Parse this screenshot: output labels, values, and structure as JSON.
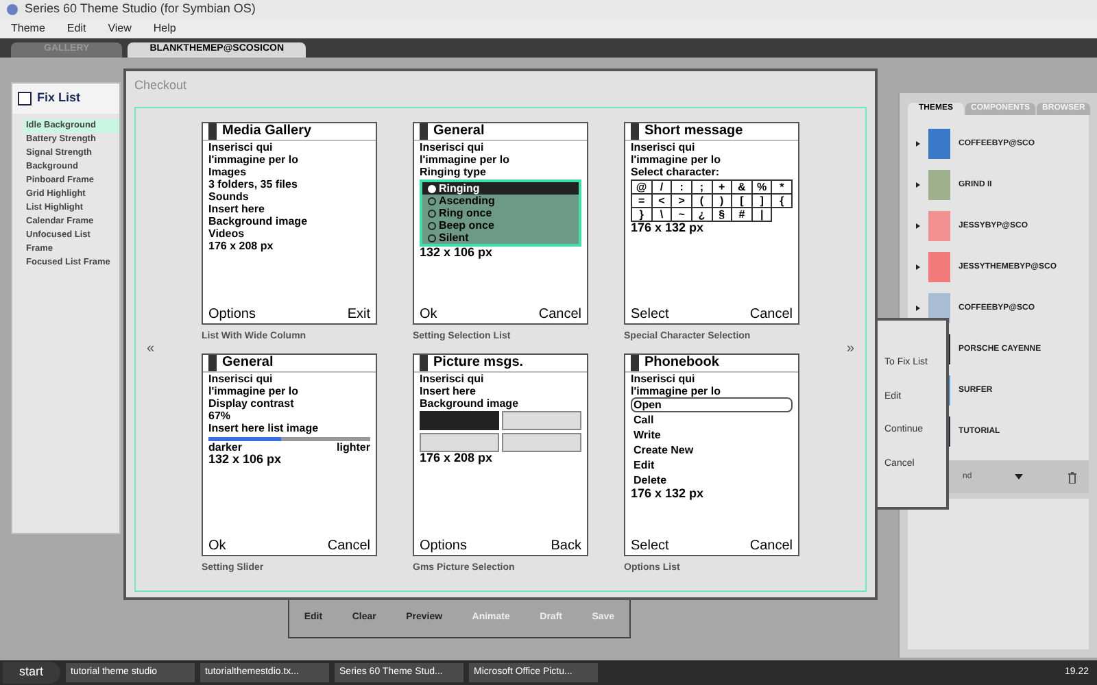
{
  "window": {
    "title": "Series 60 Theme Studio (for Symbian OS)"
  },
  "menu": [
    "Theme",
    "Edit",
    "View",
    "Help"
  ],
  "tabs": [
    {
      "label": "GALLERY",
      "selected": false
    },
    {
      "label": "BLANKTHEMEP@SCOSICON",
      "selected": true
    }
  ],
  "fix_list": {
    "title": "Fix List",
    "items": [
      {
        "label": "Idle Background",
        "selected": true
      },
      {
        "label": "Battery Strength",
        "selected": false
      },
      {
        "label": "Signal Strength",
        "selected": false
      },
      {
        "label": "Background",
        "selected": false
      },
      {
        "label": "Pinboard Frame",
        "selected": false
      },
      {
        "label": "Grid Highlight",
        "selected": false
      },
      {
        "label": "List Highlight",
        "selected": false
      },
      {
        "label": "Calendar Frame",
        "selected": false
      },
      {
        "label": "Unfocused List Frame",
        "selected": false
      },
      {
        "label": "Focused List Frame",
        "selected": false
      }
    ]
  },
  "checkout": {
    "title": "Checkout",
    "prev": "«",
    "next": "»",
    "screens": [
      {
        "kind": "list",
        "title": "Media Gallery",
        "lines": [
          "Inserisci qui",
          "l'immagine per lo",
          "Images",
          "3 folders, 35 files",
          "Sounds",
          "Insert here",
          "Background image",
          "Videos",
          "176 x 208 px"
        ],
        "softkeys": [
          "Options",
          "Exit"
        ],
        "caption": "List With Wide Column"
      },
      {
        "kind": "radio",
        "title": "General",
        "lines": [
          "Inserisci qui",
          "l'immagine per lo",
          "Ringing type"
        ],
        "options": [
          {
            "label": "Ringing",
            "selected": true
          },
          {
            "label": "Ascending",
            "selected": false
          },
          {
            "label": "Ring once",
            "selected": false
          },
          {
            "label": "Beep once",
            "selected": false
          },
          {
            "label": "Silent",
            "selected": false
          }
        ],
        "footer": "132 x 106 px",
        "softkeys": [
          "Ok",
          "Cancel"
        ],
        "caption": "Setting Selection List"
      },
      {
        "kind": "chars",
        "title": "Short message",
        "lines": [
          "Inserisci qui",
          "l'immagine per lo",
          "Select character:"
        ],
        "chars": [
          "@",
          "/",
          ":",
          ";",
          "+",
          "&",
          "%",
          "*",
          "=",
          "<",
          ">",
          "(",
          ")",
          "[",
          "]",
          "{",
          "}",
          "\\",
          "~",
          "¿",
          "§",
          "#",
          "|"
        ],
        "footer": "176 x 132 px",
        "softkeys": [
          "Select",
          "Cancel"
        ],
        "caption": "Special Character Selection"
      },
      {
        "kind": "slider",
        "title": "General",
        "lines": [
          "Inserisci qui",
          "l'immagine per lo",
          "Display contrast",
          "67%",
          "Insert here list image"
        ],
        "level": 0.45,
        "ends": [
          "darker",
          "lighter"
        ],
        "footer": "132 x 106 px",
        "softkeys": [
          "Ok",
          "Cancel"
        ],
        "caption": "Setting Slider"
      },
      {
        "kind": "pictures",
        "title": "Picture msgs.",
        "lines": [
          "Inserisci qui",
          "Insert here",
          "Background image"
        ],
        "footer": "176 x 208 px",
        "softkeys": [
          "Options",
          "Back"
        ],
        "caption": "Gms Picture Selection"
      },
      {
        "kind": "options",
        "title": "Phonebook",
        "lines": [
          "Inserisci qui",
          "l'immagine per lo"
        ],
        "options": [
          {
            "label": "Open",
            "selected": true
          },
          {
            "label": "Call",
            "selected": false
          },
          {
            "label": "Write",
            "selected": false
          },
          {
            "label": "Create New",
            "selected": false
          },
          {
            "label": "Edit",
            "selected": false
          },
          {
            "label": "Delete",
            "selected": false
          }
        ],
        "footer": "176 x 132 px",
        "softkeys": [
          "Select",
          "Cancel"
        ],
        "caption": "Options List"
      }
    ]
  },
  "popup_menu": [
    "To Fix List",
    "Edit",
    "Continue",
    "Cancel"
  ],
  "toolbar": [
    {
      "label": "Edit",
      "disabled": false
    },
    {
      "label": "Clear",
      "disabled": false
    },
    {
      "label": "Preview",
      "disabled": false
    },
    {
      "label": "Animate",
      "disabled": true
    },
    {
      "label": "Draft",
      "disabled": true
    },
    {
      "label": "Save",
      "disabled": true
    }
  ],
  "themes_panel": {
    "tabs": [
      {
        "label": "THEMES",
        "selected": true
      },
      {
        "label": "COMPONENTS",
        "selected": false
      },
      {
        "label": "BROWSER",
        "selected": false
      }
    ],
    "items": [
      {
        "name": "COFFEEBYP@SCO",
        "color": "#3a78c8"
      },
      {
        "name": "GRIND II",
        "color": "#9fb08f"
      },
      {
        "name": "JESSYBYP@SCO",
        "color": "#f09090"
      },
      {
        "name": "JESSYTHEMEBYP@SCO",
        "color": "#f27a7a"
      },
      {
        "name": "COFFEEBYP@SCO",
        "color": "#a8bcd4"
      },
      {
        "name": "PORSCHE CAYENNE",
        "color": "#222222"
      },
      {
        "name": "SURFER",
        "color": "#5a9ad8"
      },
      {
        "name": "TUTORIAL",
        "color": "#1c2a3a"
      }
    ],
    "sort": "nd"
  },
  "taskbar": {
    "start": "start",
    "tasks": [
      "tutorial theme studio",
      "tutorialthemestdio.tx...",
      "Series 60 Theme Stud...",
      "Microsoft Office Pictu..."
    ],
    "clock": "19.22"
  }
}
